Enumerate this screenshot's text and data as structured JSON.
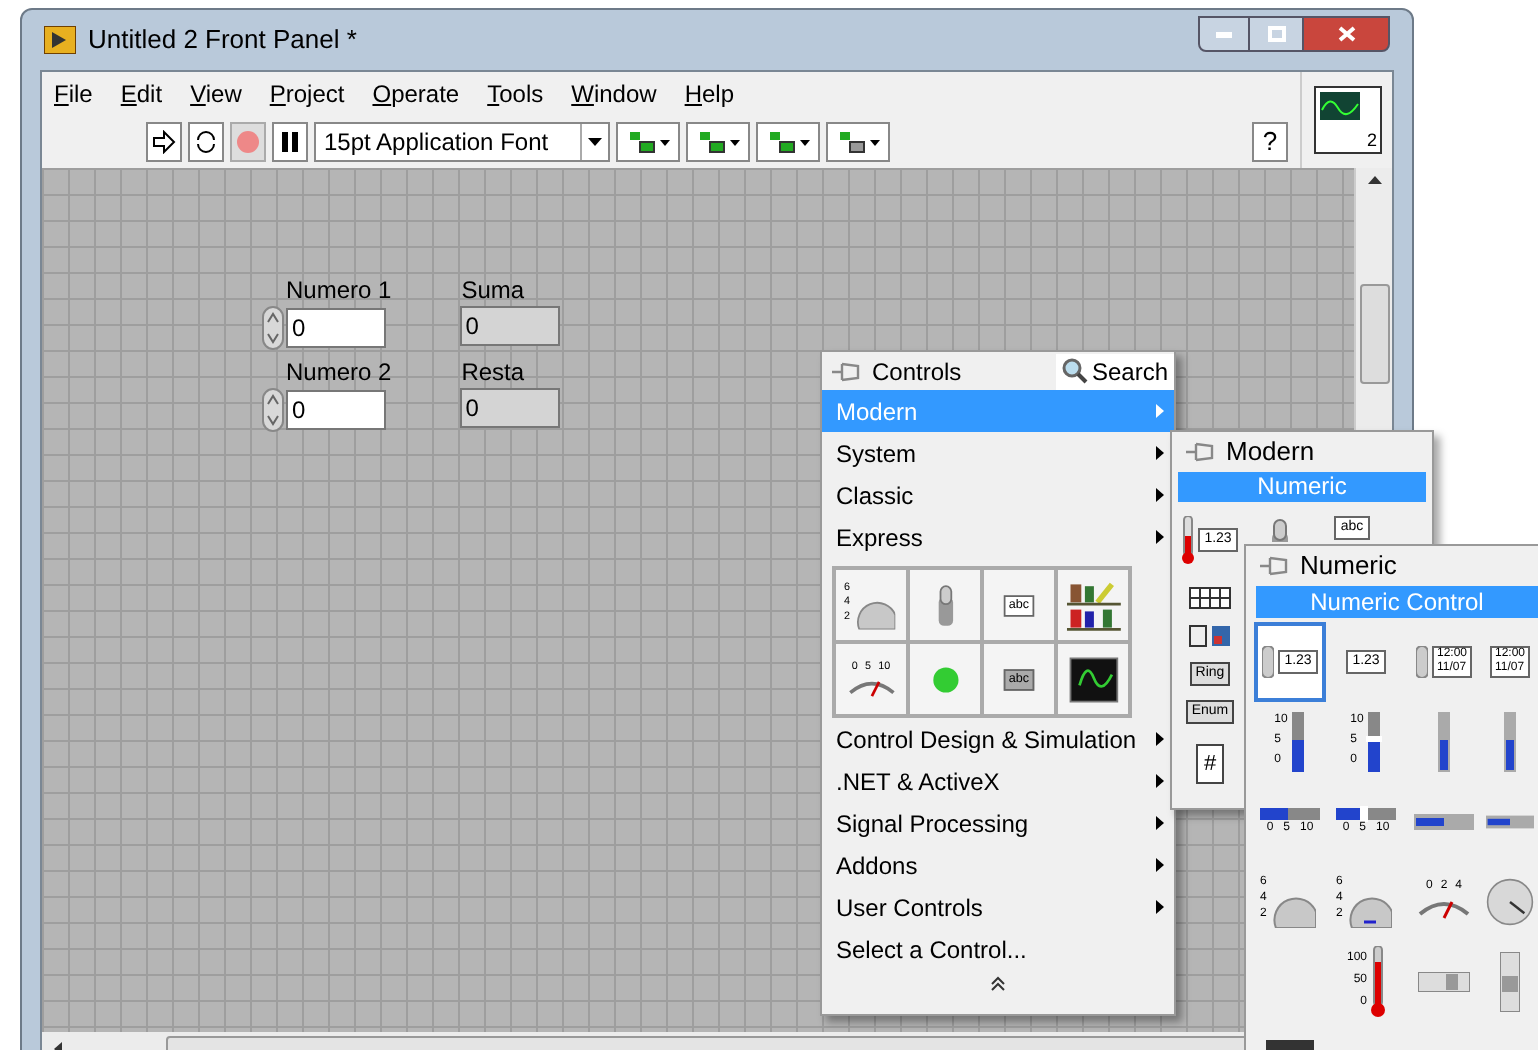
{
  "window": {
    "title": "Untitled 2 Front Panel *",
    "connector_number": "2"
  },
  "menu": [
    "File",
    "Edit",
    "View",
    "Project",
    "Operate",
    "Tools",
    "Window",
    "Help"
  ],
  "toolbar": {
    "font": "15pt Application Font",
    "help": "?"
  },
  "front_panel": {
    "controls": [
      {
        "label": "Numero 1",
        "value": "0",
        "kind": "control"
      },
      {
        "label": "Suma",
        "value": "0",
        "kind": "indicator"
      },
      {
        "label": "Numero 2",
        "value": "0",
        "kind": "control"
      },
      {
        "label": "Resta",
        "value": "0",
        "kind": "indicator"
      }
    ]
  },
  "controls_palette": {
    "title": "Controls",
    "search": "Search",
    "categories": [
      {
        "label": "Modern",
        "selected": true
      },
      {
        "label": "System",
        "selected": false
      },
      {
        "label": "Classic",
        "selected": false
      },
      {
        "label": "Express",
        "selected": false
      }
    ],
    "tiles": [
      {
        "kind": "knob",
        "scale": [
          "6",
          "4",
          "2"
        ]
      },
      {
        "kind": "toggle"
      },
      {
        "kind": "string",
        "text": "abc"
      },
      {
        "kind": "decorations"
      },
      {
        "kind": "meter",
        "scale": [
          "0",
          "5",
          "10"
        ]
      },
      {
        "kind": "led"
      },
      {
        "kind": "string-indicator",
        "text": "abc"
      },
      {
        "kind": "graph"
      }
    ],
    "more_categories": [
      {
        "label": "Control Design & Simulation",
        "submenu": true
      },
      {
        "label": ".NET & ActiveX",
        "submenu": true
      },
      {
        "label": "Signal Processing",
        "submenu": true
      },
      {
        "label": "Addons",
        "submenu": true
      },
      {
        "label": "User Controls",
        "submenu": true
      },
      {
        "label": "Select a Control...",
        "submenu": false
      }
    ]
  },
  "modern_palette": {
    "title": "Modern",
    "category": "Numeric",
    "tiles": [
      {
        "kind": "thermometer-numeric",
        "text": "1.23"
      },
      {
        "kind": "toggle"
      },
      {
        "kind": "string",
        "text": "abc"
      }
    ],
    "column_tiles": [
      {
        "kind": "array"
      },
      {
        "kind": "cluster"
      },
      {
        "kind": "ring",
        "text": "Ring"
      },
      {
        "kind": "enum",
        "text": "Enum"
      },
      {
        "kind": "refnum",
        "text": "#"
      }
    ]
  },
  "numeric_palette": {
    "title": "Numeric",
    "category": "Numeric Control",
    "tiles": [
      {
        "kind": "numeric-control",
        "text": "1.23",
        "selected": true
      },
      {
        "kind": "numeric-indicator",
        "text": "1.23",
        "selected": false
      },
      {
        "kind": "time-control",
        "lines": [
          "12:00",
          "11/07"
        ],
        "selected": false
      },
      {
        "kind": "time-indicator",
        "lines": [
          "12:00",
          "11/07"
        ],
        "selected": false
      },
      {
        "kind": "vertical-slide",
        "scale": [
          "10",
          "5",
          "0"
        ],
        "selected": false
      },
      {
        "kind": "vertical-pointer-slide",
        "scale": [
          "10",
          "5",
          "0"
        ],
        "selected": false
      },
      {
        "kind": "vertical-fill",
        "selected": false
      },
      {
        "kind": "vertical-progress",
        "selected": false
      },
      {
        "kind": "horizontal-slide",
        "scale": [
          "0",
          "5",
          "10"
        ],
        "selected": false
      },
      {
        "kind": "horizontal-pointer-slide",
        "scale": [
          "0",
          "5",
          "10"
        ],
        "selected": false
      },
      {
        "kind": "horizontal-fill",
        "selected": false
      },
      {
        "kind": "horizontal-progress",
        "selected": false
      },
      {
        "kind": "knob",
        "scale": [
          "6",
          "4",
          "2"
        ],
        "selected": false
      },
      {
        "kind": "dial",
        "scale": [
          "6",
          "4",
          "2"
        ],
        "selected": false
      },
      {
        "kind": "meter",
        "scale": [
          "0",
          "2",
          "4"
        ],
        "selected": false
      },
      {
        "kind": "gauge",
        "selected": false
      },
      {
        "kind": "empty"
      },
      {
        "kind": "thermometer",
        "scale": [
          "100",
          "50",
          "0"
        ],
        "selected": false
      },
      {
        "kind": "horizontal-scrollbar",
        "selected": false
      },
      {
        "kind": "vertical-scrollbar",
        "selected": false
      },
      {
        "kind": "color-box",
        "selected": false
      }
    ]
  }
}
